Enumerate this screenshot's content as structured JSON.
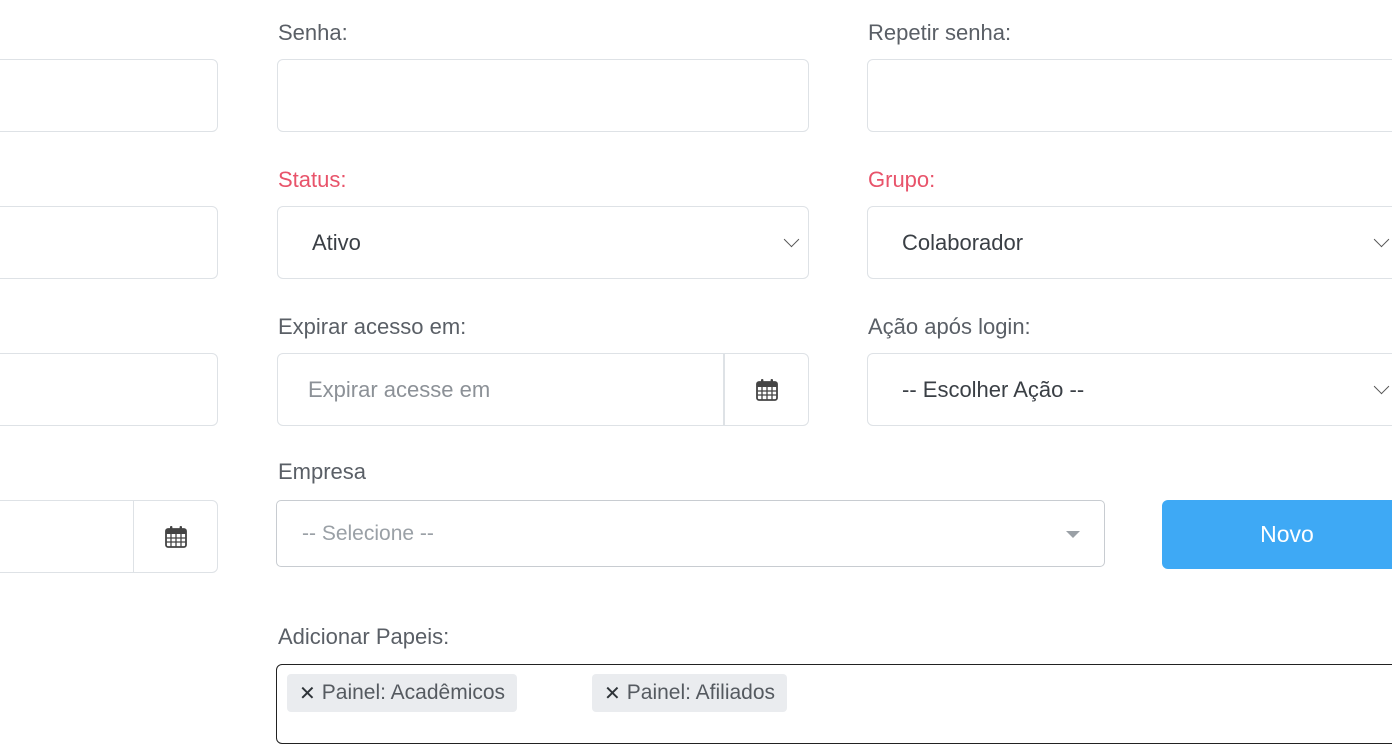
{
  "form": {
    "senha_label": "Senha:",
    "senha_value": "",
    "repetir_label": "Repetir senha:",
    "repetir_value": "",
    "status_label": "Status:",
    "status_value": "Ativo",
    "grupo_label": "Grupo:",
    "grupo_value": "Colaborador",
    "expirar_label": "Expirar acesso em:",
    "expirar_placeholder": "Expirar acesse em",
    "acao_label": "Ação após login:",
    "acao_value": "-- Escolher Ação --",
    "empresa_label": "Empresa",
    "empresa_placeholder": "-- Selecione --",
    "novo_label": "Novo",
    "papeis_label": "Adicionar Papeis:",
    "papeis": [
      {
        "remove": "✕",
        "label": "Painel: Acadêmicos"
      },
      {
        "remove": "✕",
        "label": "Painel: Afiliados"
      }
    ]
  },
  "icons": {
    "calendar": "calendar-icon",
    "chevron": "chevron-down-icon",
    "remove": "close-icon"
  },
  "colors": {
    "required_label": "#e8536a",
    "primary_button": "#3ea9f5",
    "tag_bg": "#eaecef",
    "border": "#dee2e6"
  }
}
